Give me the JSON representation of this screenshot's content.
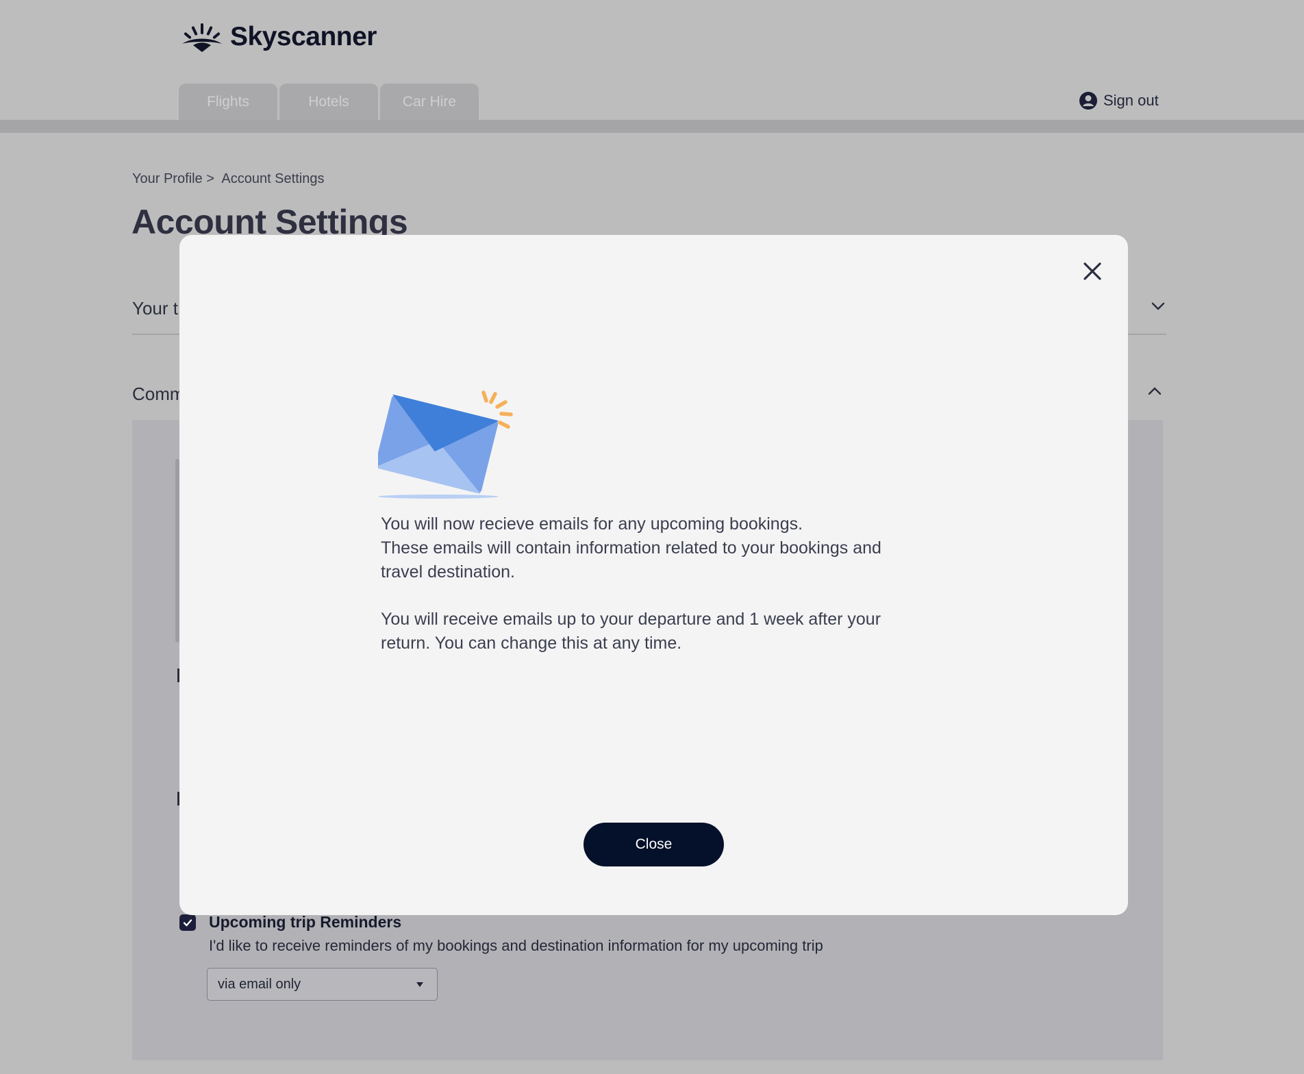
{
  "header": {
    "logo_text": "Skyscanner",
    "tabs": [
      {
        "label": "Flights"
      },
      {
        "label": "Hotels"
      },
      {
        "label": "Car Hire"
      }
    ],
    "sign_out_label": "Sign out"
  },
  "breadcrumb": {
    "parent": "Your Profile >",
    "current": "Account Settings"
  },
  "page": {
    "title": "Account Settings",
    "sections": [
      {
        "label": "Your t"
      },
      {
        "label": "Comm"
      }
    ]
  },
  "reminders": {
    "checked": true,
    "title": "Upcoming trip Reminders",
    "description": "I'd like to receive reminders of my bookings and destination information for my upcoming trip",
    "select_value": "via email only"
  },
  "modal": {
    "paragraph_1": "You will now recieve emails for any upcoming bookings.\nThese emails will contain  information related to your bookings and\ntravel destination.",
    "paragraph_2": "You will receive emails up to your departure and 1 week after your\nreturn. You can change this at any time.",
    "close_button_label": "Close",
    "icons": {
      "close": "close-icon",
      "illustration": "envelope-icon"
    }
  },
  "colors": {
    "primary_button": "#05112a",
    "envelope_blue": "#3f7fd9",
    "sparkle_orange": "#f5b05a"
  }
}
